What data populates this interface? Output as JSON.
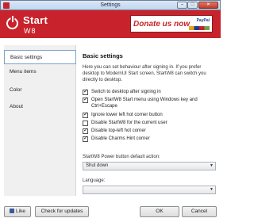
{
  "window": {
    "title": "Settings",
    "minimize": "–",
    "maximize": "□",
    "close": "✕"
  },
  "header": {
    "logo_start": "Start",
    "logo_w8": "W8",
    "donate_text": "Donate us now",
    "paypal": "PayPal"
  },
  "sidebar": {
    "items": [
      {
        "label": "Basic settings",
        "selected": true
      },
      {
        "label": "Menu items",
        "selected": false
      },
      {
        "label": "Color",
        "selected": false
      },
      {
        "label": "About",
        "selected": false
      }
    ]
  },
  "content": {
    "heading": "Basic settings",
    "description": "Here you can set behaviour after signing in. If you prefer desktop to ModernUI Start screen, StartW8 can switch you directly to desktop.",
    "checkboxes": [
      {
        "label": "Switch to desktop after signing in",
        "checked": true
      },
      {
        "label": "Open StartW8 Start menu using Windows key and Ctrl+Escape",
        "checked": true
      },
      {
        "label": "Ignore lower left hot corner button",
        "checked": true
      },
      {
        "label": "Disable StartW8 for the current user",
        "checked": false
      },
      {
        "label": "Disable top-left hot corner",
        "checked": true
      },
      {
        "label": "Disable Charms Hint corner",
        "checked": true
      }
    ],
    "power_label": "StartW8 Power button default action:",
    "power_value": "Shut down",
    "language_label": "Language:",
    "language_value": ""
  },
  "footer": {
    "like": "Like",
    "check_updates": "Check for updates",
    "ok": "OK",
    "cancel": "Cancel"
  },
  "colors": {
    "brand": "#c8232c",
    "selection_border": "#7da2ce"
  }
}
